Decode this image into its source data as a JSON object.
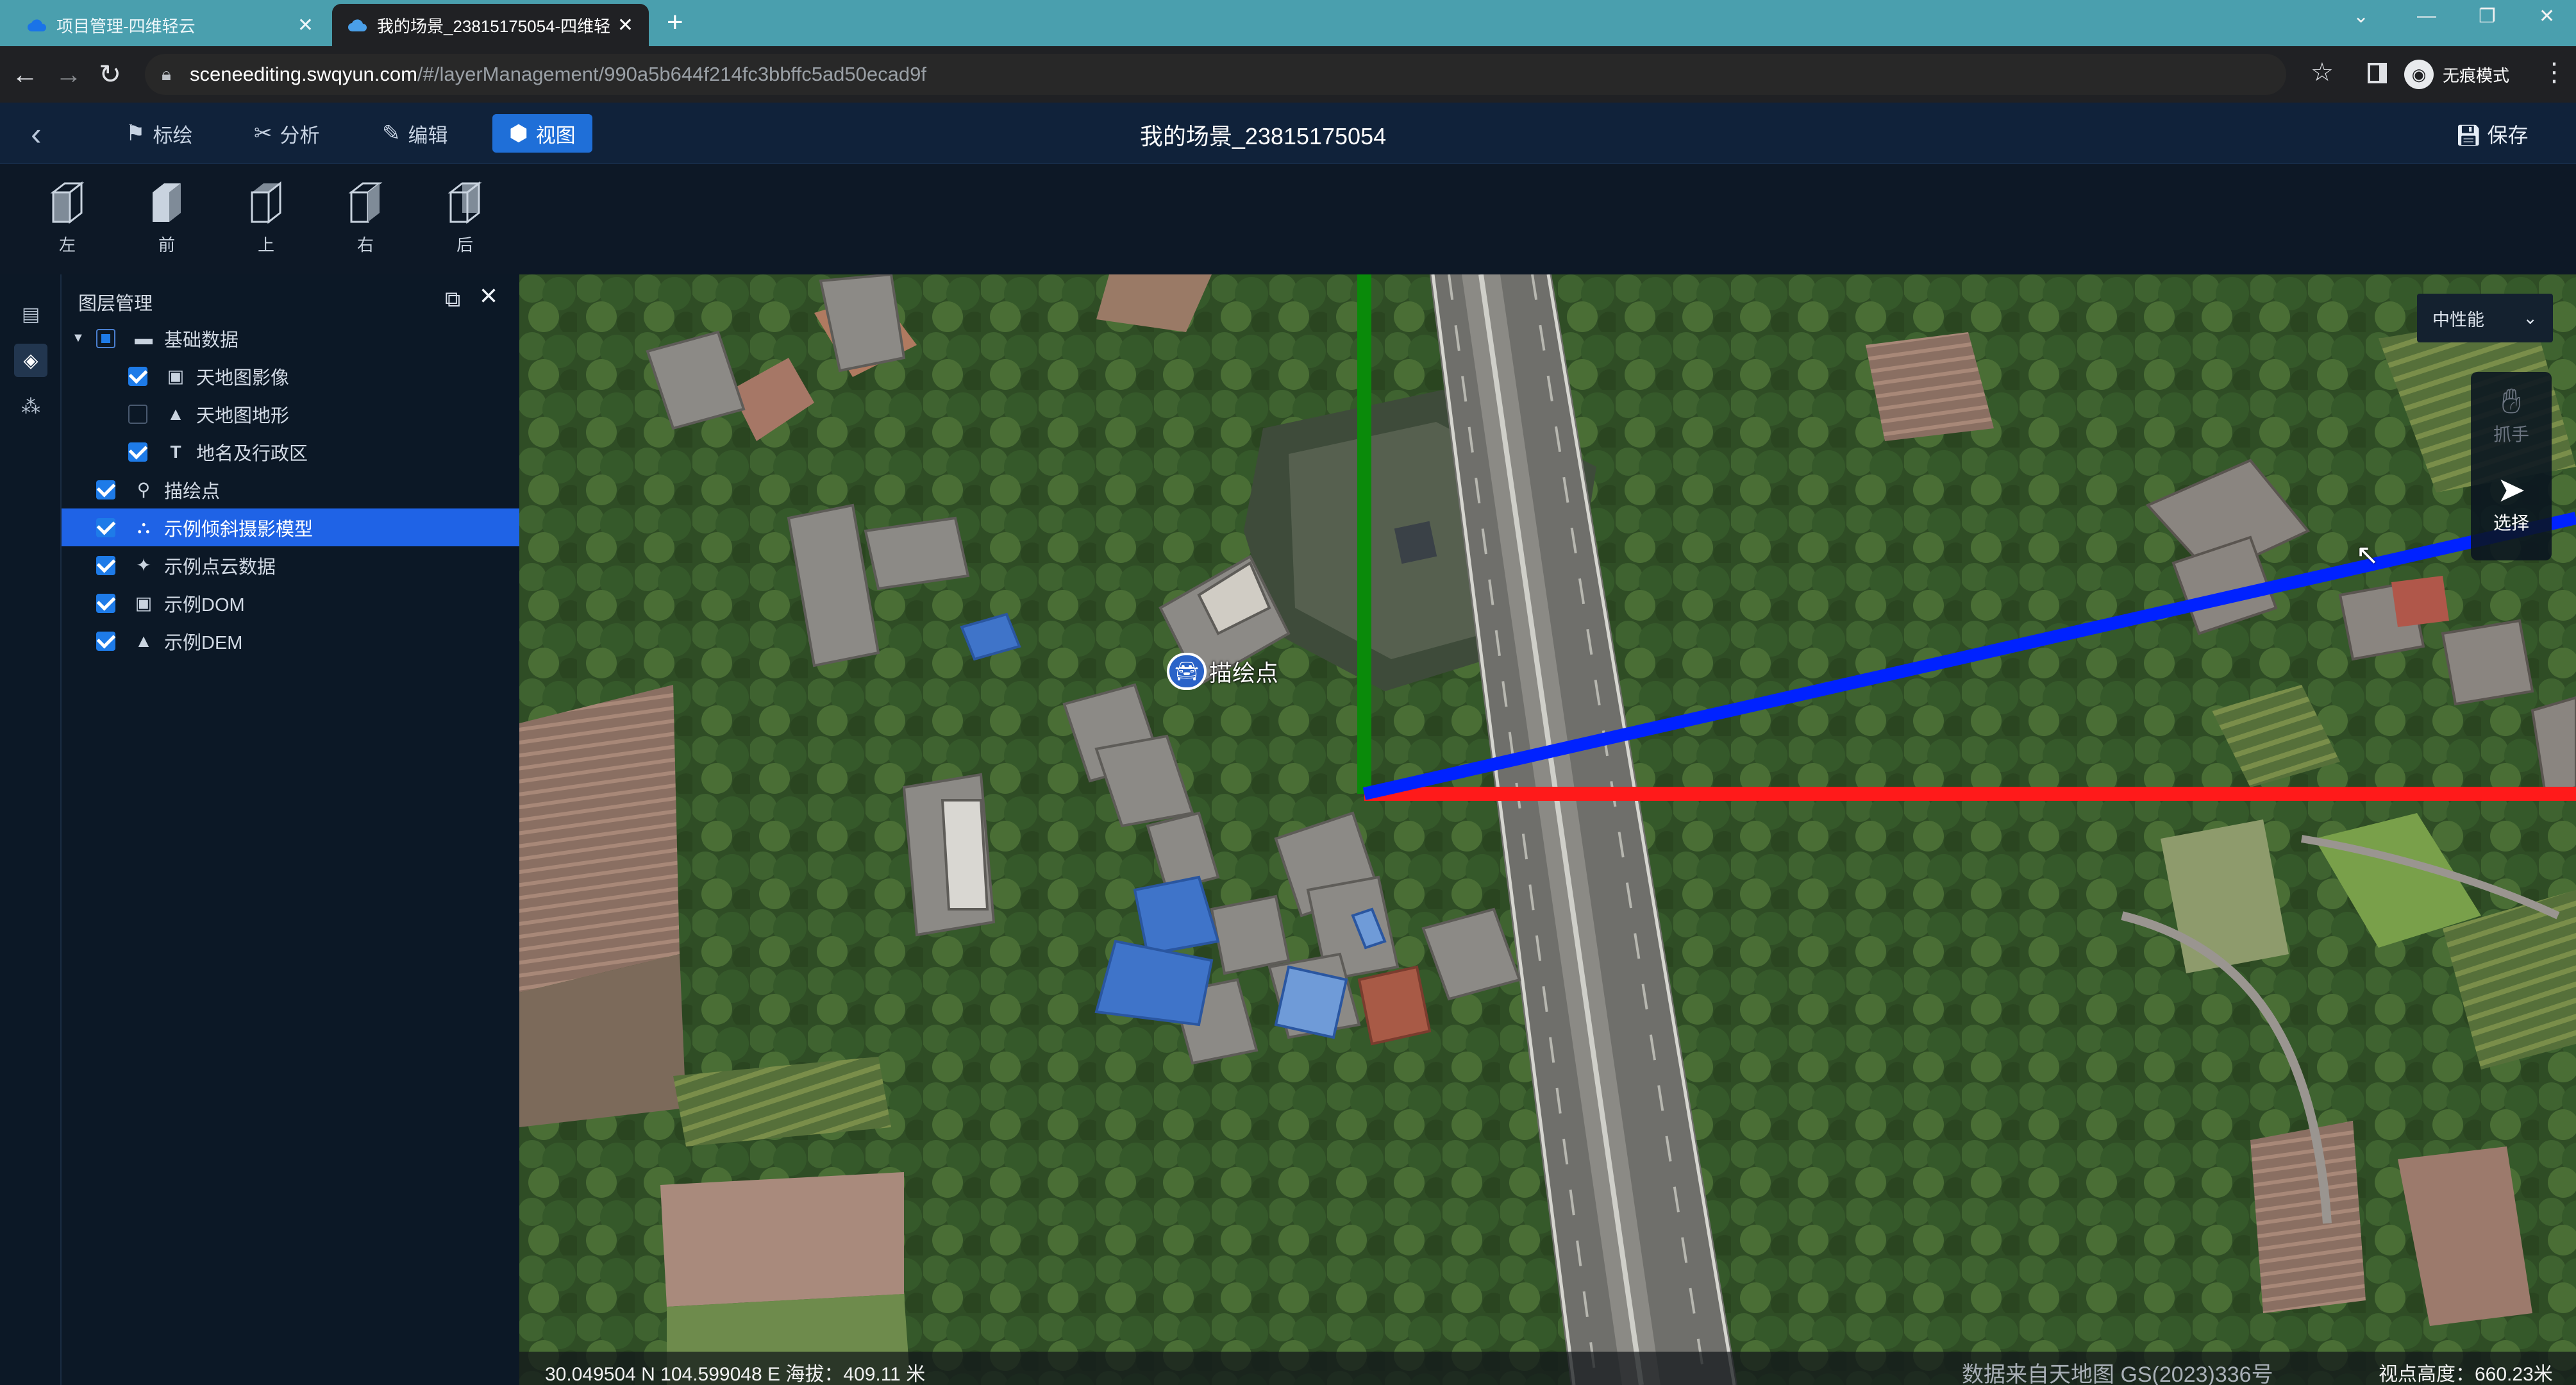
{
  "browser": {
    "tabs": [
      {
        "title": "项目管理-四维轻云",
        "active": false
      },
      {
        "title": "我的场景_23815175054-四维轻",
        "active": true
      }
    ],
    "new_tab_symbol": "+",
    "url_host": "sceneediting.swqyun.com",
    "url_path": "/#/layerManagement/990a5b644f214fc3bbffc5ad50ecad9f",
    "incognito_label": "无痕模式",
    "icons": [
      "back-arrow-icon",
      "forward-arrow-icon",
      "reload-icon",
      "lock-icon",
      "star-icon",
      "side-panel-icon",
      "incognito-icon",
      "more-vert-icon"
    ]
  },
  "header": {
    "tabs": [
      {
        "label": "标绘",
        "icon": "flag-icon"
      },
      {
        "label": "分析",
        "icon": "tools-icon"
      },
      {
        "label": "编辑",
        "icon": "pen-icon"
      },
      {
        "label": "视图",
        "icon": "cube-icon",
        "active": true
      }
    ],
    "scene_title": "我的场景_23815175054",
    "save_label": "保存"
  },
  "view_toolbar": [
    {
      "label": "左"
    },
    {
      "label": "前"
    },
    {
      "label": "上"
    },
    {
      "label": "右"
    },
    {
      "label": "后"
    }
  ],
  "layer_panel": {
    "title": "图层管理",
    "layers": [
      {
        "label": "基础数据",
        "icon": "folder-icon",
        "state": "partial",
        "level": 0,
        "expanded": true
      },
      {
        "label": "天地图影像",
        "icon": "image-icon",
        "state": "on",
        "level": 1
      },
      {
        "label": "天地图地形",
        "icon": "terrain-icon",
        "state": "off",
        "level": 1
      },
      {
        "label": "地名及行政区",
        "icon": "text-icon",
        "state": "on",
        "level": 1
      },
      {
        "label": "描绘点",
        "icon": "pin-icon",
        "state": "on",
        "level": 0
      },
      {
        "label": "示例倾斜摄影模型",
        "icon": "model-icon",
        "state": "on",
        "level": 0,
        "selected": true
      },
      {
        "label": "示例点云数据",
        "icon": "pointcloud-icon",
        "state": "on",
        "level": 0
      },
      {
        "label": "示例DOM",
        "icon": "image-icon",
        "state": "on",
        "level": 0
      },
      {
        "label": "示例DEM",
        "icon": "terrain-icon",
        "state": "on",
        "level": 0
      }
    ]
  },
  "map": {
    "marker_label": "描绘点",
    "performance_mode": "中性能",
    "tools": {
      "grab": "抓手",
      "select": "选择"
    },
    "coordinates": "30.049504 N 104.599048 E 海拔：409.11 米",
    "data_source": "数据来自天地图 GS(2023)336号",
    "camera_height": "视点高度：660.23米",
    "axis_colors": {
      "x": "#ff1a1a",
      "y": "#0022ff",
      "z": "#0a8a0a"
    }
  }
}
